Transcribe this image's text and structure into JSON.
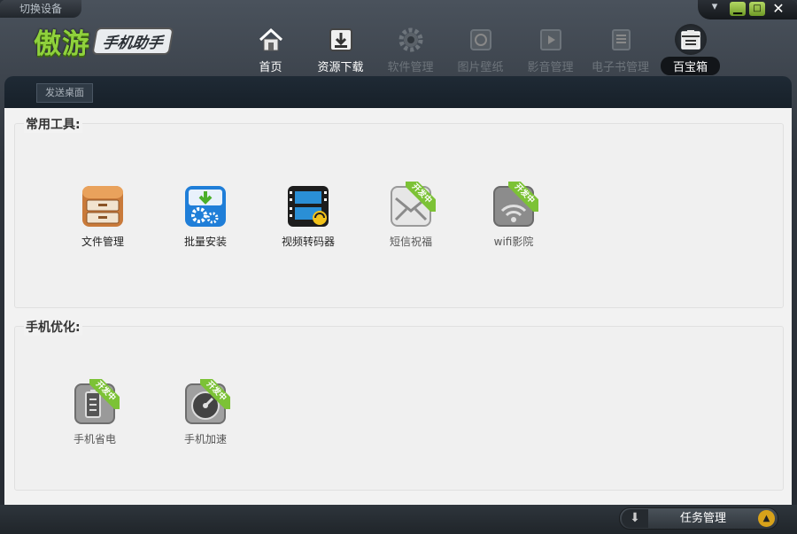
{
  "titlebar": {
    "switch_device": "切换设备"
  },
  "logo": {
    "main": "傲游",
    "sub": "手机助手"
  },
  "window_controls": {
    "menu": "▾",
    "minimize": "▁",
    "maximize": "□",
    "close": "✕"
  },
  "nav": {
    "items": [
      {
        "label": "首页",
        "icon": "home-icon",
        "state": "normal"
      },
      {
        "label": "资源下载",
        "icon": "download-icon",
        "state": "normal"
      },
      {
        "label": "软件管理",
        "icon": "gear-icon",
        "state": "disabled"
      },
      {
        "label": "图片壁纸",
        "icon": "picture-icon",
        "state": "disabled"
      },
      {
        "label": "影音管理",
        "icon": "film-icon",
        "state": "disabled"
      },
      {
        "label": "电子书管理",
        "icon": "book-icon",
        "state": "disabled"
      },
      {
        "label": "百宝箱",
        "icon": "toolbox-icon",
        "state": "active"
      }
    ]
  },
  "subbar": {
    "send_desktop": "发送桌面"
  },
  "sections": {
    "common_tools": {
      "title": "常用工具:",
      "tools": [
        {
          "label": "文件管理",
          "icon": "file-cabinet-icon"
        },
        {
          "label": "批量安装",
          "icon": "batch-install-icon"
        },
        {
          "label": "视频转码器",
          "icon": "video-converter-icon"
        },
        {
          "label": "短信祝福",
          "icon": "sms-greeting-icon",
          "badge": "开发中"
        },
        {
          "label": "wifi影院",
          "icon": "wifi-cinema-icon",
          "badge": "开发中"
        }
      ]
    },
    "phone_optimize": {
      "title": "手机优化:",
      "tools": [
        {
          "label": "手机省电",
          "icon": "battery-saver-icon",
          "badge": "开发中"
        },
        {
          "label": "手机加速",
          "icon": "speedometer-icon",
          "badge": "开发中"
        }
      ]
    }
  },
  "footer": {
    "task_manager": "任务管理",
    "left_icon": "⬇",
    "arrow": "▲"
  },
  "colors": {
    "accent_green": "#7cc236",
    "logo_green": "#8fd13c",
    "footer_arrow": "#d8a21a"
  }
}
